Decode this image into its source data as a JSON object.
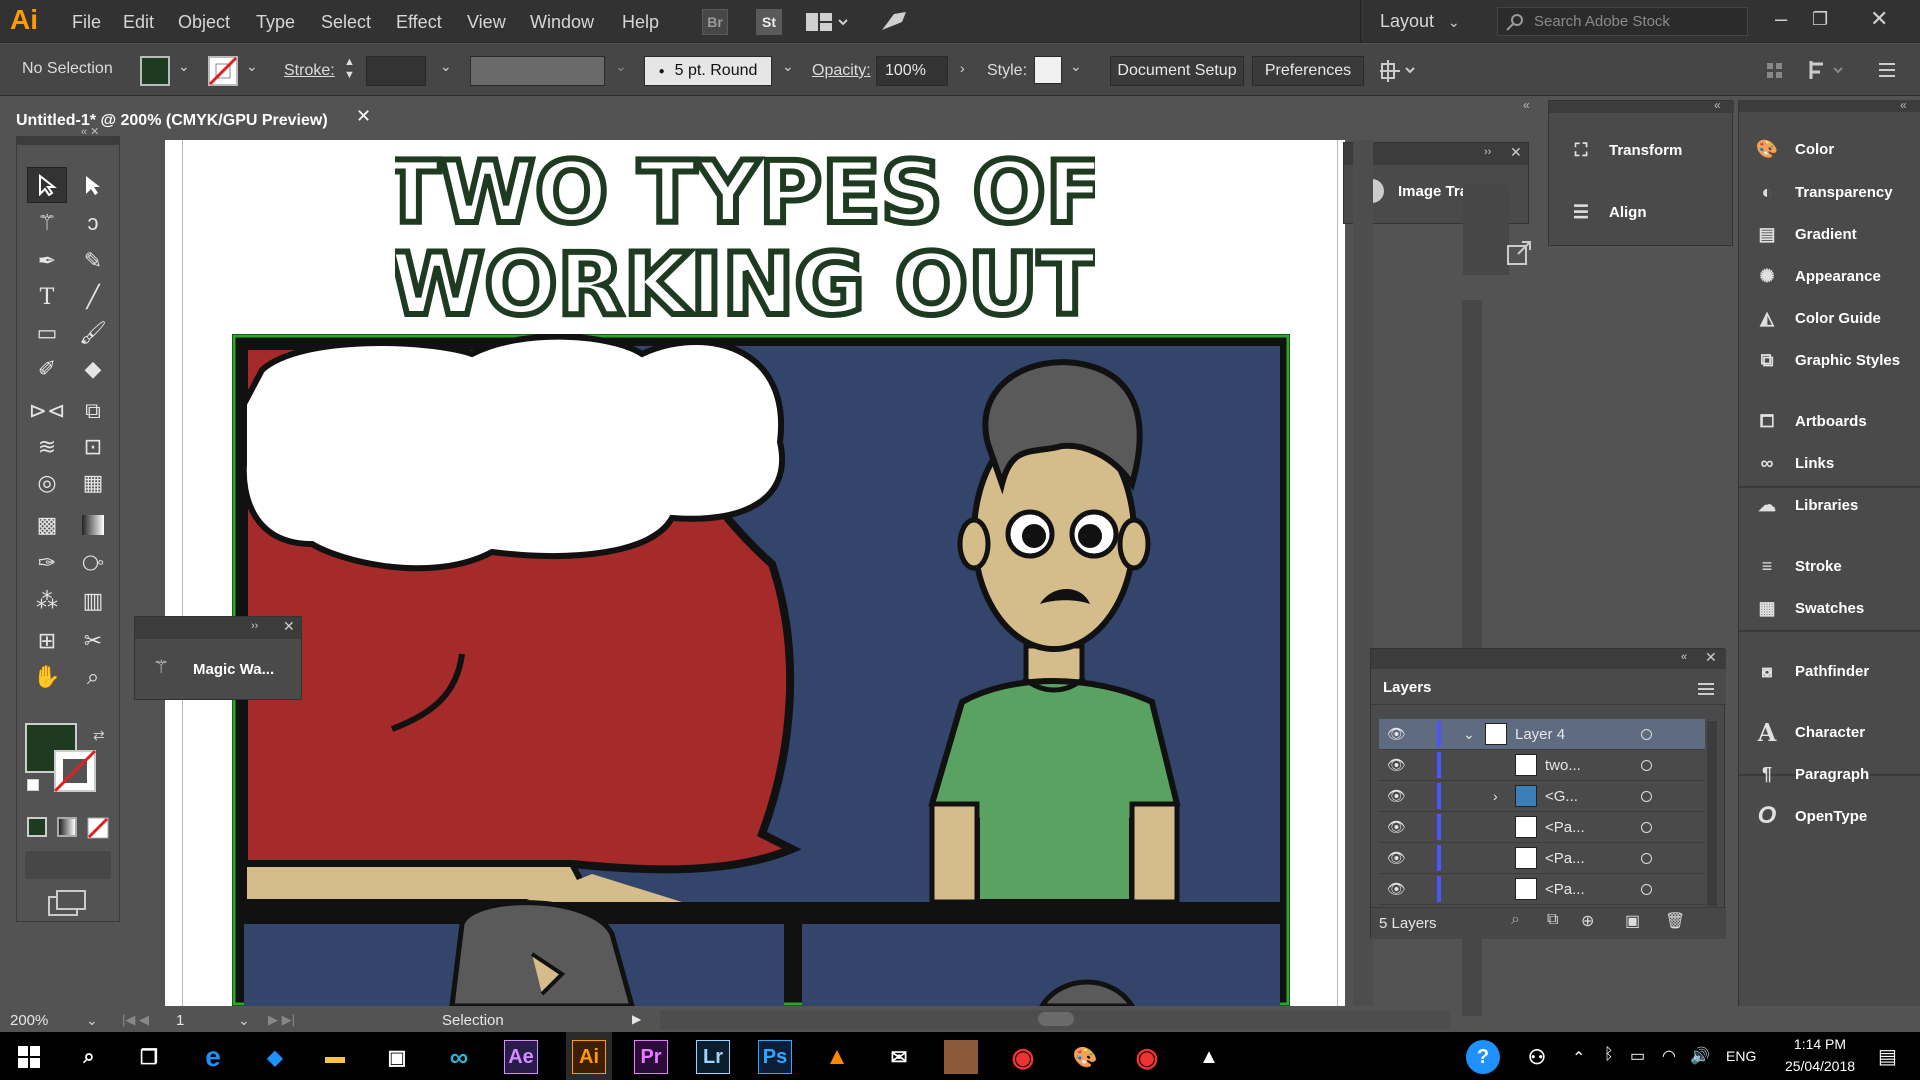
{
  "app": {
    "logo": "Ai"
  },
  "menu": {
    "items": [
      "File",
      "Edit",
      "Object",
      "Type",
      "Select",
      "Effect",
      "View",
      "Window",
      "Help"
    ],
    "bridge": "Br",
    "stock": "St",
    "layout": "Layout",
    "search_placeholder": "Search Adobe Stock"
  },
  "control": {
    "no_selection": "No Selection",
    "stroke_label": "Stroke:",
    "brush": "5 pt. Round",
    "opacity_label": "Opacity:",
    "opacity_value": "100%",
    "style_label": "Style:",
    "document_setup": "Document Setup",
    "preferences": "Preferences"
  },
  "document": {
    "tab_title": "Untitled-1* @ 200% (CMYK/GPU Preview)"
  },
  "artwork": {
    "title_line1": "TWO TYPES OF",
    "title_line2": "WORKING OUT"
  },
  "panels": {
    "image_trace": "Image Trace",
    "magic_wand": "Magic Wa...",
    "dock_col1": [
      {
        "label": "Transform",
        "icon": "transform-icon"
      },
      {
        "label": "Align",
        "icon": "align-icon"
      }
    ],
    "dock_col2": [
      {
        "label": "Color",
        "icon": "color-icon"
      },
      {
        "label": "Transparency",
        "icon": "transparency-icon"
      },
      {
        "label": "Gradient",
        "icon": "gradient-icon"
      },
      {
        "label": "Appearance",
        "icon": "appearance-icon"
      },
      {
        "label": "Color Guide",
        "icon": "color-guide-icon"
      },
      {
        "label": "Graphic Styles",
        "icon": "graphic-styles-icon"
      },
      {
        "label": "Artboards",
        "icon": "artboards-icon"
      },
      {
        "label": "Links",
        "icon": "links-icon"
      },
      {
        "label": "Libraries",
        "icon": "libraries-icon"
      },
      {
        "label": "Stroke",
        "icon": "stroke-icon"
      },
      {
        "label": "Swatches",
        "icon": "swatches-icon"
      },
      {
        "label": "Pathfinder",
        "icon": "pathfinder-icon"
      },
      {
        "label": "Character",
        "icon": "character-icon"
      },
      {
        "label": "Paragraph",
        "icon": "paragraph-icon"
      },
      {
        "label": "OpenType",
        "icon": "opentype-icon"
      }
    ]
  },
  "layers": {
    "title": "Layers",
    "count": "5 Layers",
    "rows": [
      {
        "name": "Layer 4"
      },
      {
        "name": "two..."
      },
      {
        "name": "<G..."
      },
      {
        "name": "<Pa..."
      },
      {
        "name": "<Pa..."
      },
      {
        "name": "<Pa..."
      }
    ]
  },
  "status": {
    "zoom": "200%",
    "artboard": "1",
    "tool": "Selection"
  },
  "taskbar": {
    "lang": "ENG",
    "time": "1:14 PM",
    "date": "25/04/2018",
    "apps": [
      "Ae",
      "Ai",
      "Pr",
      "Lr",
      "Ps"
    ]
  },
  "colors": {
    "fill": "#1e3a21",
    "accent": "#4da3ff",
    "ai_orange": "#ff9a00",
    "title_green": "#1e3a21",
    "comic_blue": "#33456b",
    "comic_red": "#a52a2a",
    "shirt_green": "#5aa262",
    "skin": "#d4bd8a"
  }
}
